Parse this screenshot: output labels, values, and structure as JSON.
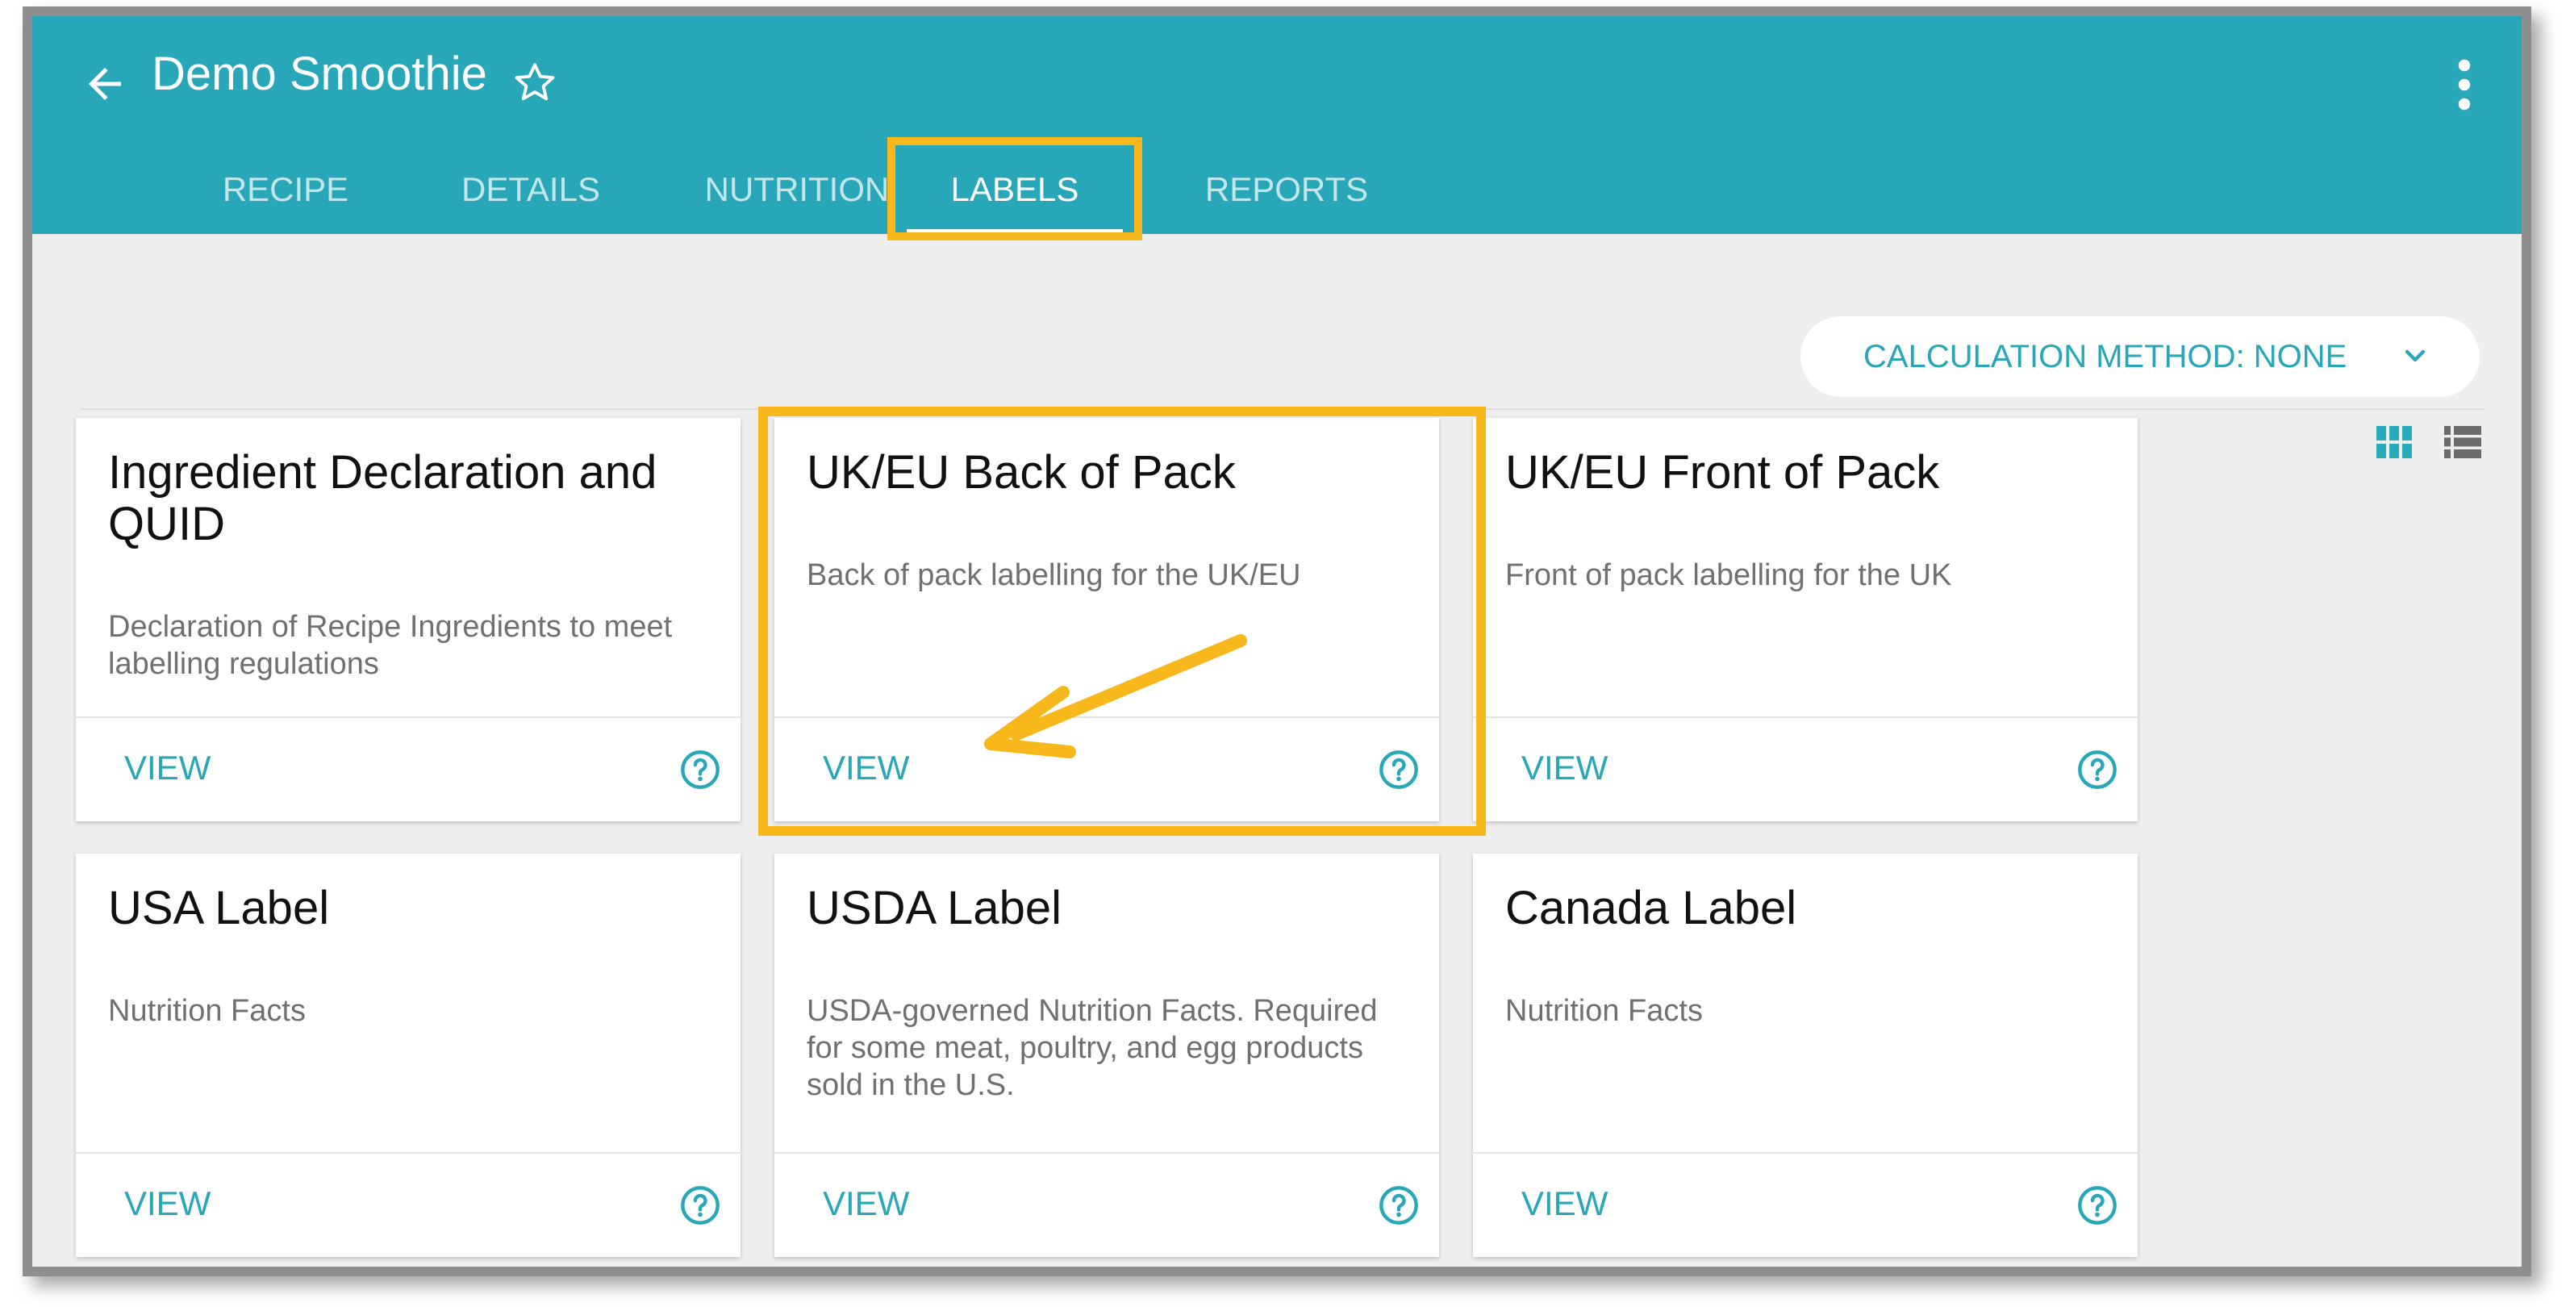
{
  "header": {
    "title": "Demo Smoothie"
  },
  "tabs": [
    {
      "label": "RECIPE",
      "active": false
    },
    {
      "label": "DETAILS",
      "active": false
    },
    {
      "label": "NUTRITION",
      "active": false
    },
    {
      "label": "LABELS",
      "active": true
    },
    {
      "label": "REPORTS",
      "active": false
    }
  ],
  "toolbar": {
    "calculation_method_label": "CALCULATION METHOD: NONE"
  },
  "cards": [
    {
      "title": "Ingredient Declaration and QUID",
      "description": "Declaration of Recipe Ingredients to meet labelling regulations",
      "action": "VIEW"
    },
    {
      "title": "UK/EU Back of Pack",
      "description": "Back of pack labelling for the UK/EU",
      "action": "VIEW"
    },
    {
      "title": "UK/EU Front of Pack",
      "description": "Front of pack labelling for the UK",
      "action": "VIEW"
    },
    {
      "title": "USA Label",
      "description": "Nutrition Facts",
      "action": "VIEW"
    },
    {
      "title": "USDA Label",
      "description": "USDA-governed Nutrition Facts. Required for some meat, poultry, and egg products sold in the U.S.",
      "action": "VIEW"
    },
    {
      "title": "Canada Label",
      "description": "Nutrition Facts",
      "action": "VIEW"
    }
  ],
  "icons": {
    "back": "arrow-back-icon",
    "favorite": "star-outline-icon",
    "menu": "more-vertical-icon",
    "dropdown": "chevron-down-icon",
    "grid_view": "grid-view-icon",
    "list_view": "list-view-icon",
    "help": "help-circle-icon"
  },
  "colors": {
    "primary": "#28a7b8",
    "highlight": "#f8b81b",
    "background": "#eeeeee"
  }
}
